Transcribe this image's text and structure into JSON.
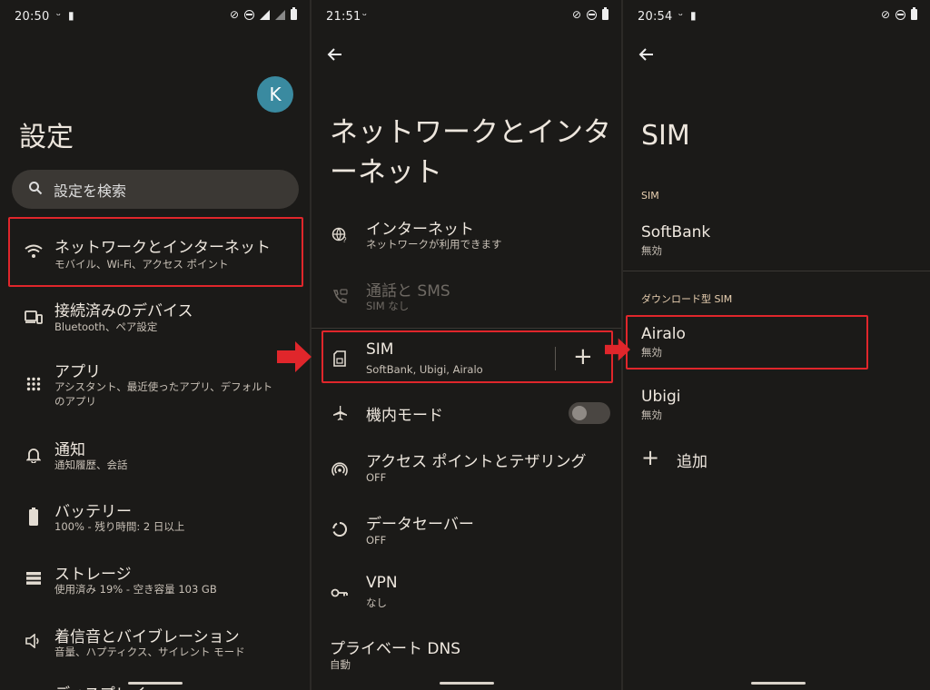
{
  "panel1": {
    "status_time": "20:50",
    "avatar_letter": "K",
    "title": "設定",
    "search_placeholder": "設定を検索",
    "items": [
      {
        "title": "ネットワークとインターネット",
        "subtitle": "モバイル、Wi-Fi、アクセス ポイント",
        "icon": "wifi-icon"
      },
      {
        "title": "接続済みのデバイス",
        "subtitle": "Bluetooth、ペア設定",
        "icon": "devices-icon"
      },
      {
        "title": "アプリ",
        "subtitle": "アシスタント、最近使ったアプリ、デフォルト のアプリ",
        "icon": "apps-grid-icon"
      },
      {
        "title": "通知",
        "subtitle": "通知履歴、会話",
        "icon": "bell-icon"
      },
      {
        "title": "バッテリー",
        "subtitle": "100% - 残り時間: 2 日以上",
        "icon": "battery-icon"
      },
      {
        "title": "ストレージ",
        "subtitle": "使用済み 19% - 空き容量 103 GB",
        "icon": "storage-icon"
      },
      {
        "title": "着信音とバイブレーション",
        "subtitle": "音量、ハプティクス、サイレント モード",
        "icon": "volume-icon"
      },
      {
        "title": "ディスプレイ",
        "subtitle": "",
        "icon": "display-icon"
      }
    ]
  },
  "panel2": {
    "status_time": "21:51",
    "title_line1": "ネットワークとインタ",
    "title_line2": "ーネット",
    "items": [
      {
        "title": "インターネット",
        "subtitle": "ネットワークが利用できます",
        "icon": "globe-icon"
      },
      {
        "title": "通話と SMS",
        "subtitle": "SIM なし",
        "icon": "call-sms-icon"
      },
      {
        "title": "SIM",
        "subtitle": "SoftBank, Ubigi, Airalo",
        "icon": "sim-icon"
      },
      {
        "title": "機内モード",
        "subtitle": "",
        "icon": "airplane-icon"
      },
      {
        "title": "アクセス ポイントとテザリング",
        "subtitle": "OFF",
        "icon": "hotspot-icon"
      },
      {
        "title": "データセーバー",
        "subtitle": "OFF",
        "icon": "data-saver-icon"
      },
      {
        "title": "VPN",
        "subtitle": "なし",
        "icon": "vpn-key-icon"
      },
      {
        "title": "プライベート DNS",
        "subtitle": "自動",
        "icon": ""
      }
    ],
    "add_symbol": "+"
  },
  "panel3": {
    "status_time": "20:54",
    "title": "SIM",
    "section1": "SIM",
    "section2": "ダウンロード型 SIM",
    "sims": [
      {
        "name": "SoftBank",
        "status": "無効"
      },
      {
        "name": "Airalo",
        "status": "無効"
      },
      {
        "name": "Ubigi",
        "status": "無効"
      }
    ],
    "add_label": "追加",
    "add_symbol": "+"
  },
  "colors": {
    "highlight": "#e0262b",
    "background": "#1b1a18",
    "avatar": "#3a8aa0"
  }
}
